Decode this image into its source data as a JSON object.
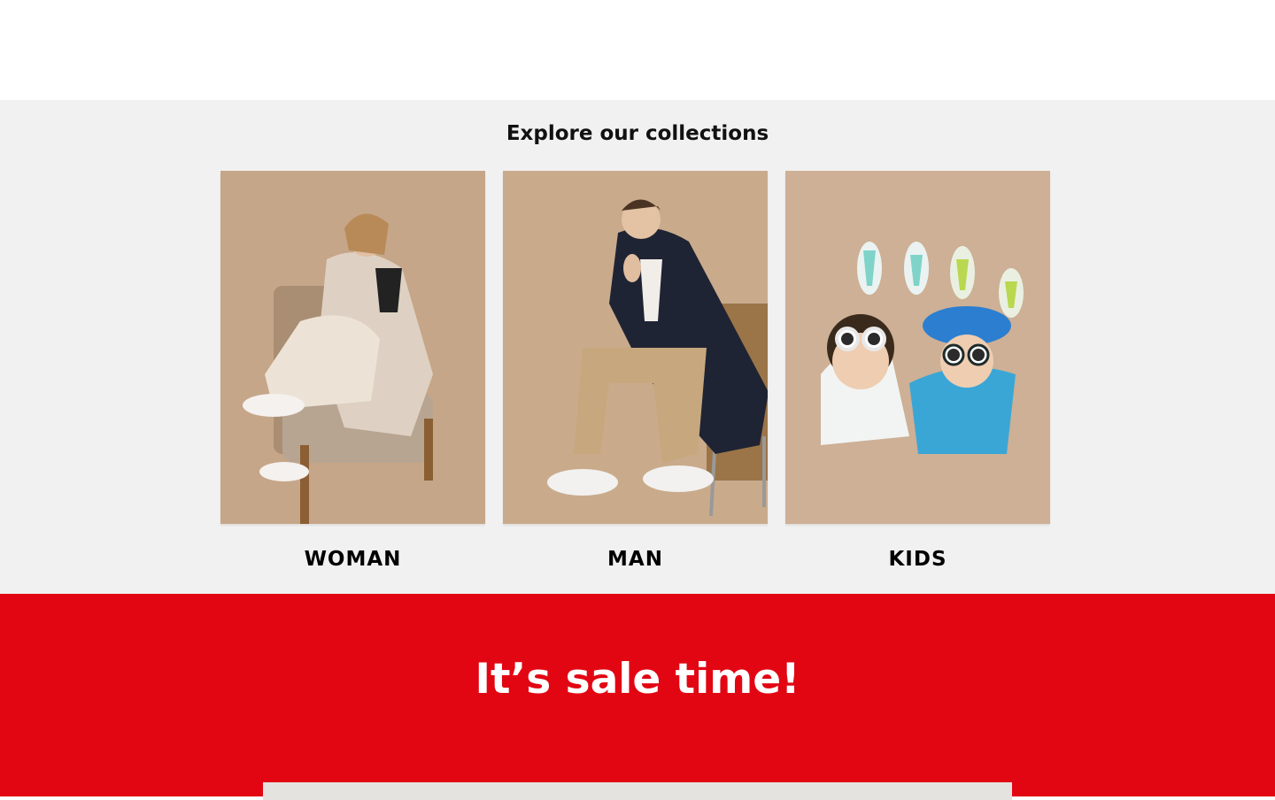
{
  "collections": {
    "title": "Explore our collections",
    "items": [
      {
        "label": "WOMAN",
        "image": "woman-in-beige-coat-on-armchair"
      },
      {
        "label": "MAN",
        "image": "man-in-navy-jacket-on-chair"
      },
      {
        "label": "KIDS",
        "image": "two-kids-with-sunglasses-lying"
      }
    ]
  },
  "sale": {
    "title": "It’s sale time!"
  },
  "colors": {
    "accent": "#e20613",
    "section_bg": "#f2f1f1",
    "photo_bg": "#c9ab8d"
  }
}
